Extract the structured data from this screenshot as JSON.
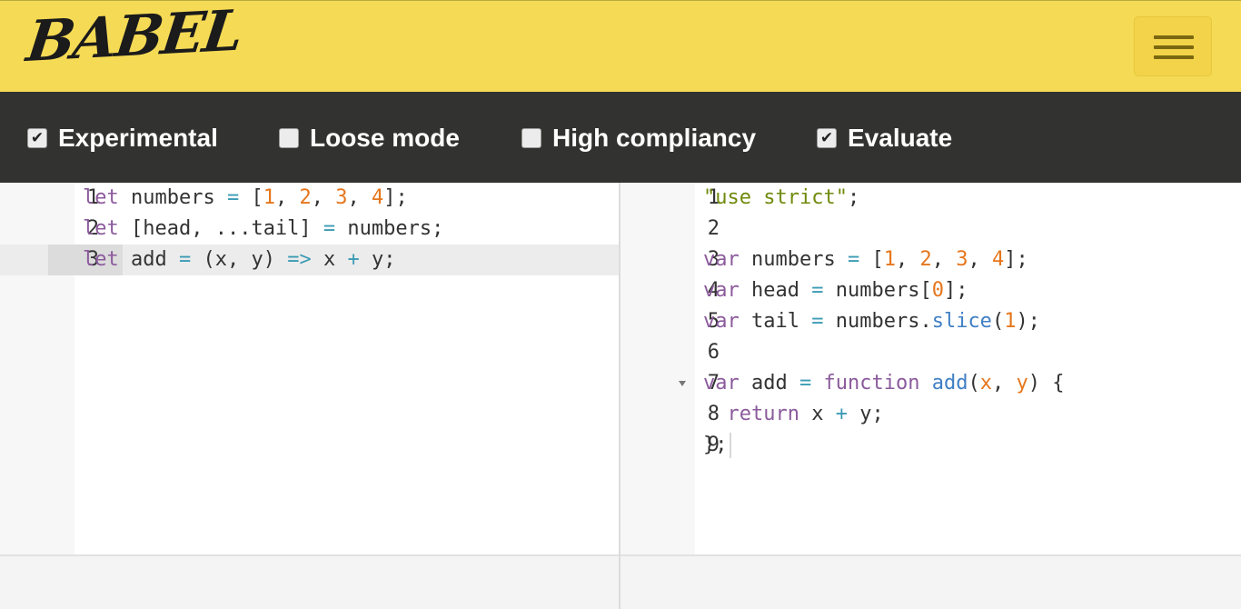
{
  "app": {
    "logo_text": "BABEL"
  },
  "header": {
    "menu_button_icon": "hamburger-menu-icon"
  },
  "colors": {
    "header_bg": "#f5da55",
    "toolbar_bg": "#323330",
    "keyword": "#8b5a9c",
    "operator": "#3c9bb4",
    "number": "#e5761c",
    "string": "#6f8a0b",
    "function": "#3f7fc4"
  },
  "options": [
    {
      "label": "Experimental",
      "checked": true
    },
    {
      "label": "Loose mode",
      "checked": false
    },
    {
      "label": "High compliancy",
      "checked": false
    },
    {
      "label": "Evaluate",
      "checked": true
    }
  ],
  "input_editor": {
    "active_line": 3,
    "lines": [
      {
        "num": "1",
        "text": "let numbers = [1, 2, 3, 4];"
      },
      {
        "num": "2",
        "text": "let [head, ...tail] = numbers;"
      },
      {
        "num": "3",
        "text": "let add = (x, y) => x + y;"
      }
    ]
  },
  "output_editor": {
    "lines": [
      {
        "num": "1",
        "text": "\"use strict\";"
      },
      {
        "num": "2",
        "text": ""
      },
      {
        "num": "3",
        "text": "var numbers = [1, 2, 3, 4];"
      },
      {
        "num": "4",
        "text": "var head = numbers[0];"
      },
      {
        "num": "5",
        "text": "var tail = numbers.slice(1);"
      },
      {
        "num": "6",
        "text": ""
      },
      {
        "num": "7",
        "text": "var add = function add(x, y) {"
      },
      {
        "num": "8",
        "text": "  return x + y;"
      },
      {
        "num": "9",
        "text": "};"
      }
    ]
  }
}
